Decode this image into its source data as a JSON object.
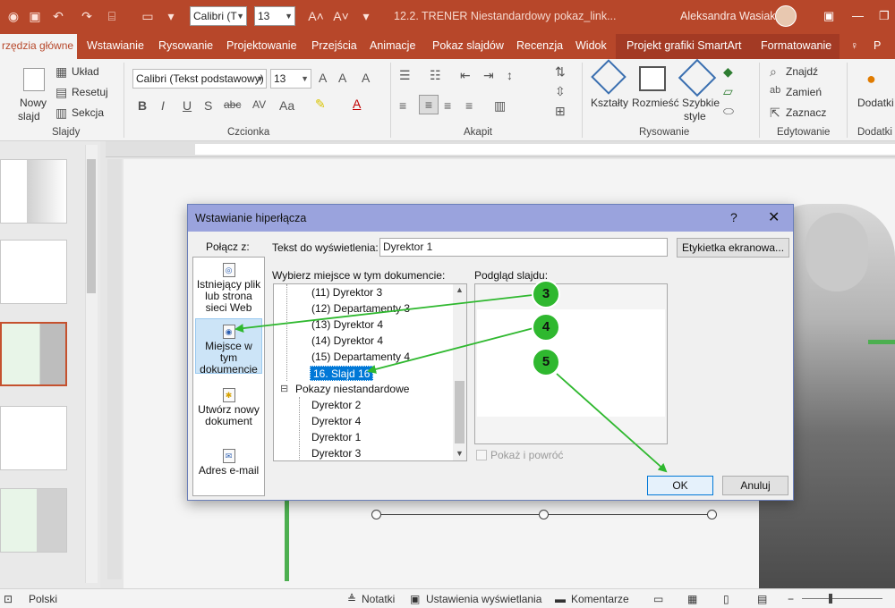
{
  "titlebar": {
    "font_name": "Calibri (T",
    "font_size": "13",
    "doc_title": "12.2. TRENER Niestandardowy pokaz_link...",
    "user": "Aleksandra Wasiak",
    "bg_color": "#b7472a"
  },
  "tabs": [
    {
      "label": "rzędzia główne"
    },
    {
      "label": "Wstawianie"
    },
    {
      "label": "Rysowanie"
    },
    {
      "label": "Projektowanie"
    },
    {
      "label": "Przejścia"
    },
    {
      "label": "Animacje"
    },
    {
      "label": "Pokaz slajdów"
    },
    {
      "label": "Recenzja"
    },
    {
      "label": "Widok"
    },
    {
      "label": "Projekt grafiki SmartArt"
    },
    {
      "label": "Formatowanie"
    }
  ],
  "ribbon": {
    "new_slide": "Nowy",
    "new_slide2": "slajd",
    "layout": "Układ",
    "reset": "Resetuj",
    "section": "Sekcja",
    "font_name": "Calibri (Tekst podstawowy)",
    "font_size": "13",
    "shapes": "Kształty",
    "arrange": "Rozmieść",
    "quick_styles": "Szybkie",
    "quick_styles2": "style",
    "find": "Znajdź",
    "replace": "Zamień",
    "select": "Zaznacz",
    "addins": "Dodatki",
    "groups": {
      "slides": "Slajdy",
      "font": "Czcionka",
      "paragraph": "Akapit",
      "drawing": "Rysowanie",
      "editing": "Edytowanie",
      "addins": "Dodatki"
    }
  },
  "dialog": {
    "title": "Wstawianie hiperłącza",
    "help": "?",
    "close": "✕",
    "link_to": "Połącz z:",
    "link_items": {
      "existing": "Istniejący plik lub strona sieci Web",
      "place": "Miejsce w tym dokumencie",
      "new_doc": "Utwórz nowy dokument",
      "email": "Adres e-mail"
    },
    "display_label": "Tekst do wyświetlenia:",
    "display_value": "Dyrektor 1",
    "screentip_button": "Etykietka ekranowa...",
    "choose_label": "Wybierz miejsce w tym dokumencie:",
    "tree": {
      "r1": "(11) Dyrektor 3",
      "r2": "(12) Departamenty 3",
      "r3": "(13) Dyrektor 4",
      "r4": "(14) Dyrektor 4",
      "r5": "(15) Departamenty 4",
      "r6": "16. Slajd 16",
      "r7": "Pokazy niestandardowe",
      "r8": "Dyrektor 2",
      "r9": "Dyrektor 4",
      "r10": "Dyrektor 1",
      "r11": "Dyrektor 3",
      "expander": "⊟"
    },
    "preview_label": "Podgląd slajdu:",
    "show_return": "Pokaż i powróć",
    "ok": "OK",
    "cancel": "Anuluj"
  },
  "annotations": [
    "3",
    "4",
    "5"
  ],
  "annotation_color": "#2fb82f",
  "statusbar": {
    "language": "Polski",
    "notes": "Notatki",
    "display_settings": "Ustawienia wyświetlania",
    "comments": "Komentarze"
  }
}
